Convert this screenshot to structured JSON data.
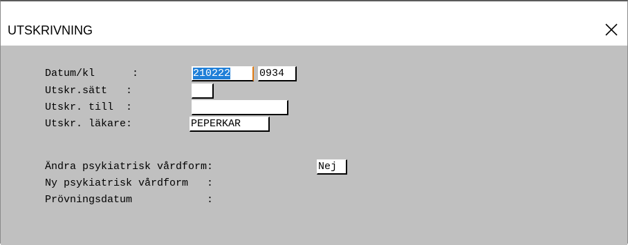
{
  "window": {
    "title": "UTSKRIVNING",
    "close_glyph": "×"
  },
  "form": {
    "datum_label": "Datum/kl      :",
    "datum_value": "210222",
    "klockslag_value": "0934",
    "utskr_satt_label": "Utskr.sätt   :",
    "utskr_satt_value": "",
    "utskr_till_label": "Utskr. till  :",
    "utskr_till_value": "",
    "utskr_lakare_label": "Utskr. läkare:",
    "utskr_lakare_value": "PEPERKAR",
    "andra_vardform_label": "Ändra psykiatrisk vårdform:",
    "andra_vardform_value": "Nej",
    "ny_vardform_label": "Ny psykiatrisk vårdform   :",
    "provningsdatum_label": "Prövningsdatum            :"
  },
  "colors": {
    "client_background": "#c0c0c0",
    "selection": "#1f7fd8",
    "focus_caret": "#e07a10"
  }
}
